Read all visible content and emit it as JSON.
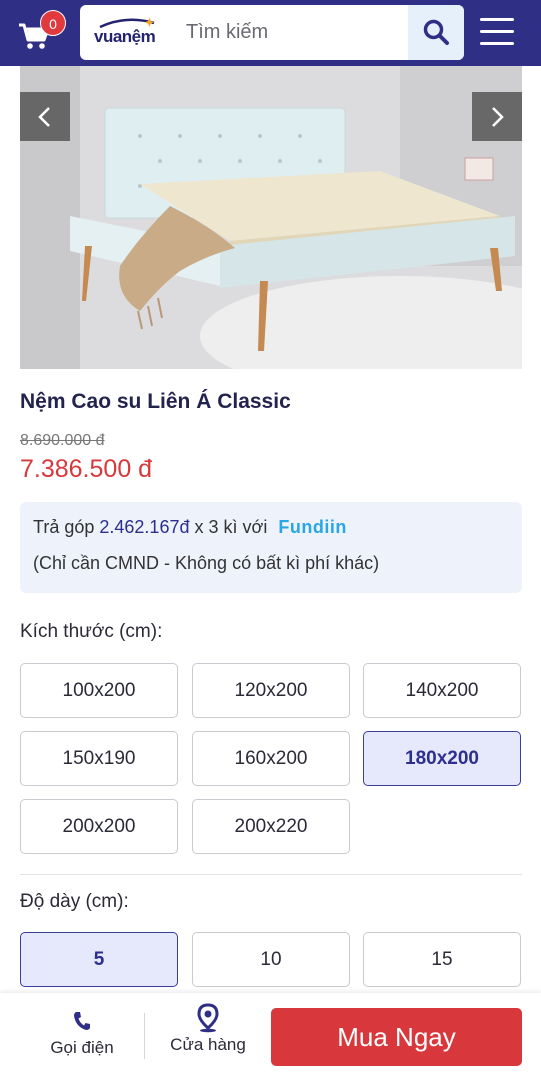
{
  "header": {
    "cart_count": "0",
    "logo_text": "vuanệm",
    "search_placeholder": "Tìm kiếm"
  },
  "product": {
    "title": "Nệm Cao su Liên Á Classic",
    "old_price": "8.690.000 đ",
    "new_price": "7.386.500 đ"
  },
  "installment": {
    "prefix": "Trả góp",
    "amount": "2.462.167đ",
    "terms": "x 3 kì với",
    "provider": "Fundiin",
    "note": "(Chỉ cần CMND - Không có bất kì phí khác)"
  },
  "sizes": {
    "label": "Kích thước (cm):",
    "options": [
      "100x200",
      "120x200",
      "140x200",
      "150x190",
      "160x200",
      "180x200",
      "200x200",
      "200x220"
    ],
    "selected": "180x200"
  },
  "thickness": {
    "label": "Độ dày (cm):",
    "options": [
      "5",
      "10",
      "15"
    ],
    "selected": "5"
  },
  "bottom_bar": {
    "call_label": "Gọi điện",
    "store_label": "Cửa hàng",
    "buy_label": "Mua Ngay"
  },
  "colors": {
    "header_bg": "#2f2f86",
    "price_red": "#d8383c",
    "selected_bg": "#e6e8fb",
    "selected_border": "#3a3d9c",
    "fundiin_blue": "#2aa6e6"
  },
  "icons": {
    "cart": "cart-icon",
    "search": "search-icon",
    "menu": "hamburger-menu-icon",
    "prev": "chevron-left-icon",
    "next": "chevron-right-icon",
    "call": "phone-icon",
    "store": "map-pin-icon"
  }
}
